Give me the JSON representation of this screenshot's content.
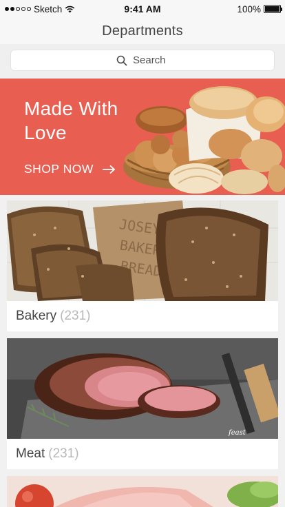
{
  "status_bar": {
    "carrier": "Sketch",
    "time": "9:41 AM",
    "battery": "100%",
    "battery_level": 1.0,
    "signal_bars_filled": 2,
    "signal_bars_total": 5
  },
  "nav": {
    "title": "Departments"
  },
  "search": {
    "placeholder": "Search",
    "value": ""
  },
  "banner": {
    "title": "Made With Love",
    "cta": "SHOP NOW",
    "color": "#e85e50",
    "icon": "arrow-right-icon"
  },
  "departments": [
    {
      "name": "Bakery",
      "count": "(231)"
    },
    {
      "name": "Meat",
      "count": "(231)"
    },
    {
      "name": "",
      "count": ""
    }
  ]
}
